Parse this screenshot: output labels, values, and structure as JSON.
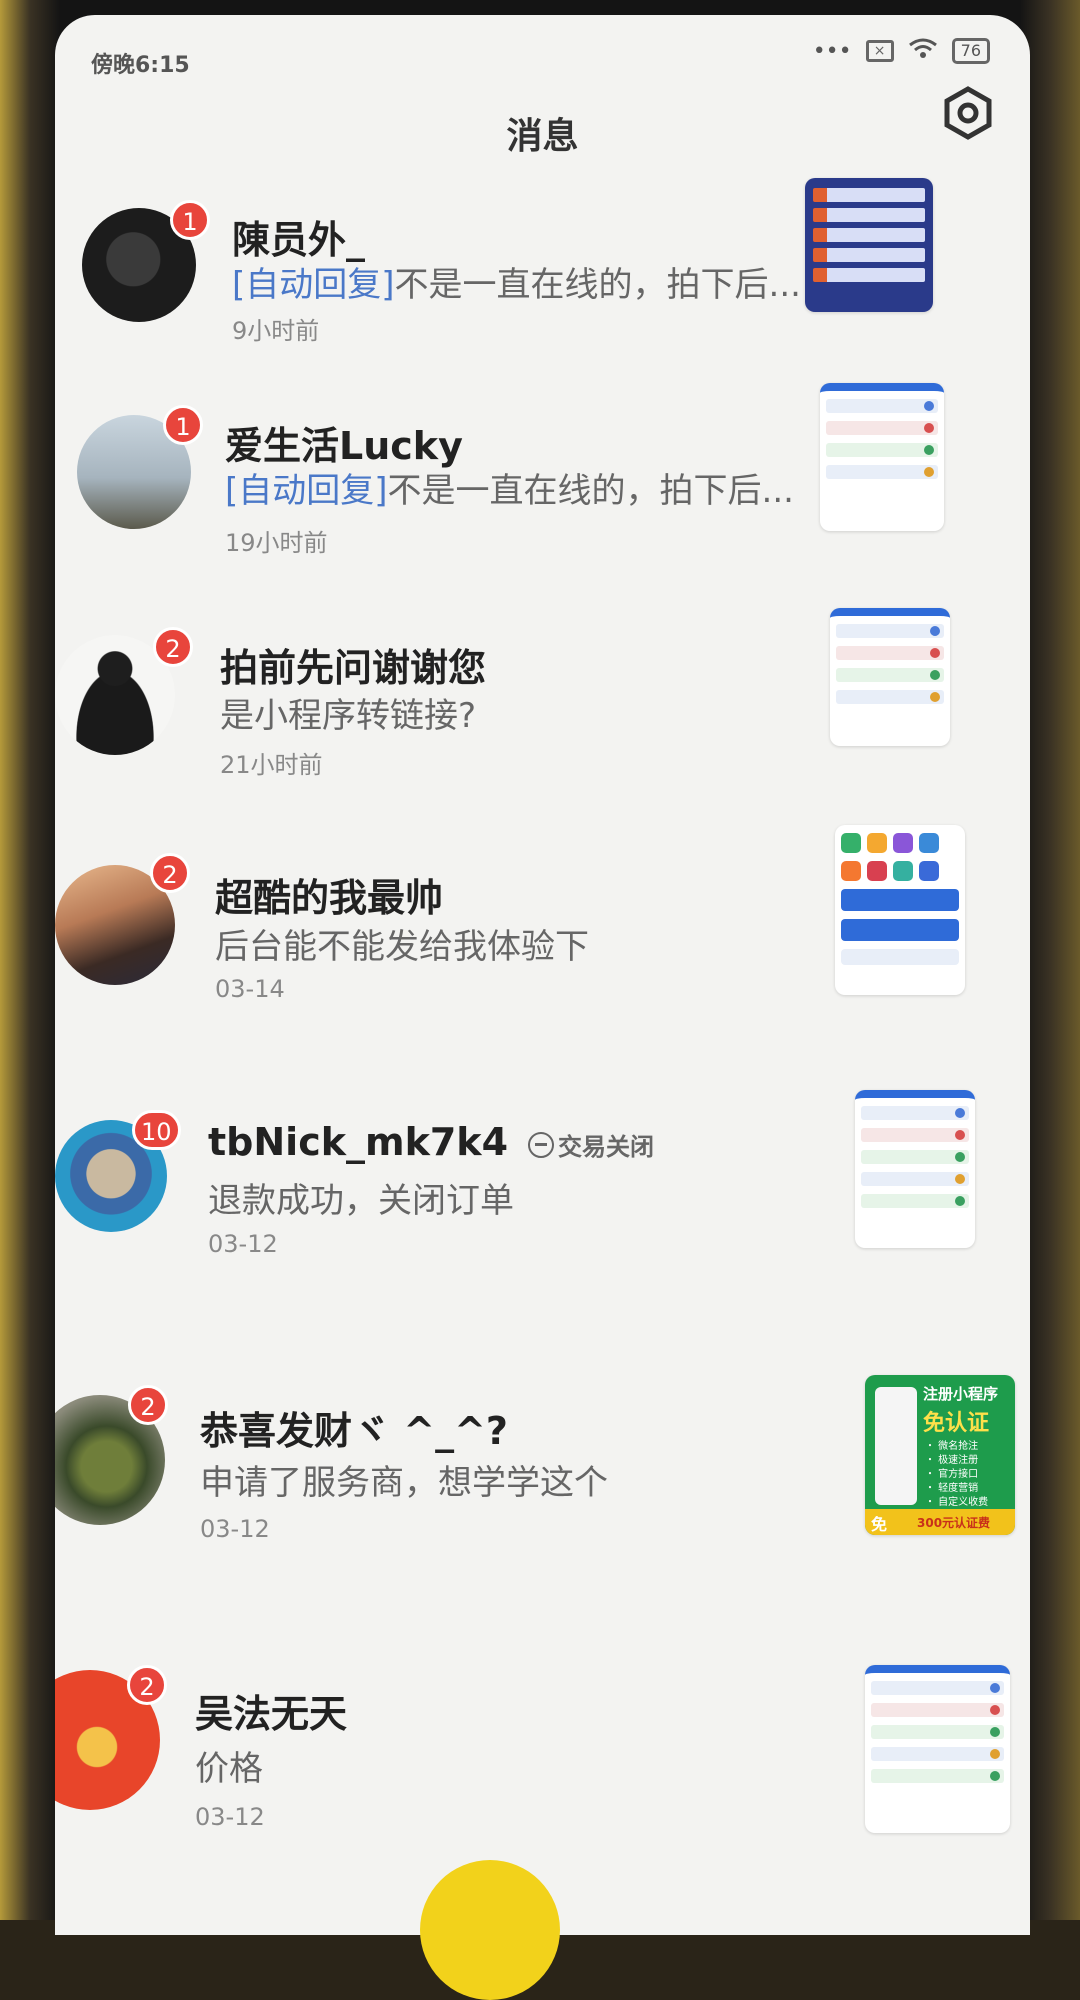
{
  "status_bar": {
    "time": "傍晚6:15",
    "battery": "76"
  },
  "header": {
    "title": "消息"
  },
  "colors": {
    "badge": "#e8453c",
    "auto_reply_tag": "#4a78c8",
    "background": "#f3f3f1"
  },
  "conversations": [
    {
      "name": "陳员外_",
      "badge": "1",
      "auto_tag": "[自动回复]",
      "message": "不是一直在线的，拍下后...",
      "time": "9小时前"
    },
    {
      "name": "爱生活Lucky",
      "badge": "1",
      "auto_tag": "[自动回复]",
      "message": "不是一直在线的，拍下后...",
      "time": "19小时前"
    },
    {
      "name": "拍前先问谢谢您",
      "badge": "2",
      "message": "是小程序转链接?",
      "time": "21小时前"
    },
    {
      "name": "超酷的我最帅",
      "badge": "2",
      "message": "后台能不能发给我体验下",
      "time": "03-14"
    },
    {
      "name": "tbNick_mk7k4",
      "badge": "10",
      "status_tag": "交易关闭",
      "message": "退款成功，关闭订单",
      "time": "03-12"
    },
    {
      "name": "恭喜发财ヾ ^_^?",
      "badge": "2",
      "message": "申请了服务商，想学学这个",
      "time": "03-12"
    },
    {
      "name": "吴法无天",
      "badge": "2",
      "message": "价格",
      "time": "03-12"
    }
  ],
  "promo_thumb": {
    "title": "注册小程序",
    "headline": "免认证",
    "bullets": [
      "・ 微名抢注",
      "・ 极速注册",
      "・ 官方接口",
      "・ 轻度营销",
      "・ 自定义收费"
    ],
    "badge": "免",
    "footer": "300元认证费"
  }
}
